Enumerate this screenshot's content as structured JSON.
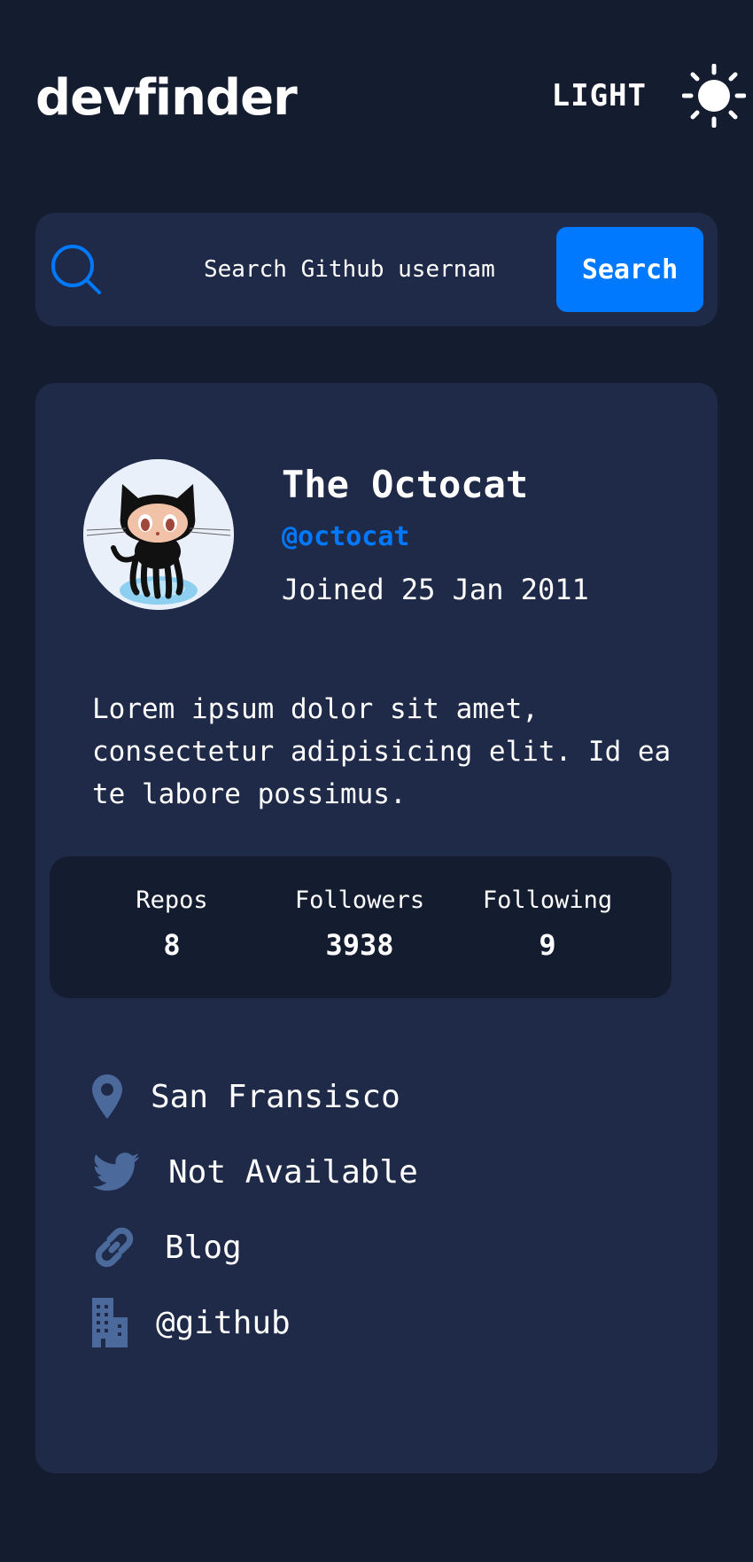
{
  "header": {
    "brand": "devfinder",
    "mode_label": "LIGHT",
    "mode_icon": "sun-icon"
  },
  "search": {
    "placeholder": "Search Github usernam",
    "button_label": "Search",
    "icon": "search-icon"
  },
  "profile": {
    "name": "The Octocat",
    "login": "@octocat",
    "joined": "Joined 25 Jan 2011",
    "bio": "Lorem ipsum dolor sit amet, consectetur adipisicing elit. Id ea te labore possimus.",
    "stats": [
      {
        "label": "Repos",
        "value": "8"
      },
      {
        "label": "Followers",
        "value": "3938"
      },
      {
        "label": "Following",
        "value": "9"
      }
    ],
    "links": {
      "location": "San Fransisco",
      "twitter": "Not Available",
      "blog": "Blog",
      "company": "@github"
    }
  },
  "colors": {
    "background": "#141C2F",
    "card": "#1F2A48",
    "accent": "#0079FF",
    "icon_muted": "#4B6A9B",
    "text": "#FFFFFF"
  }
}
